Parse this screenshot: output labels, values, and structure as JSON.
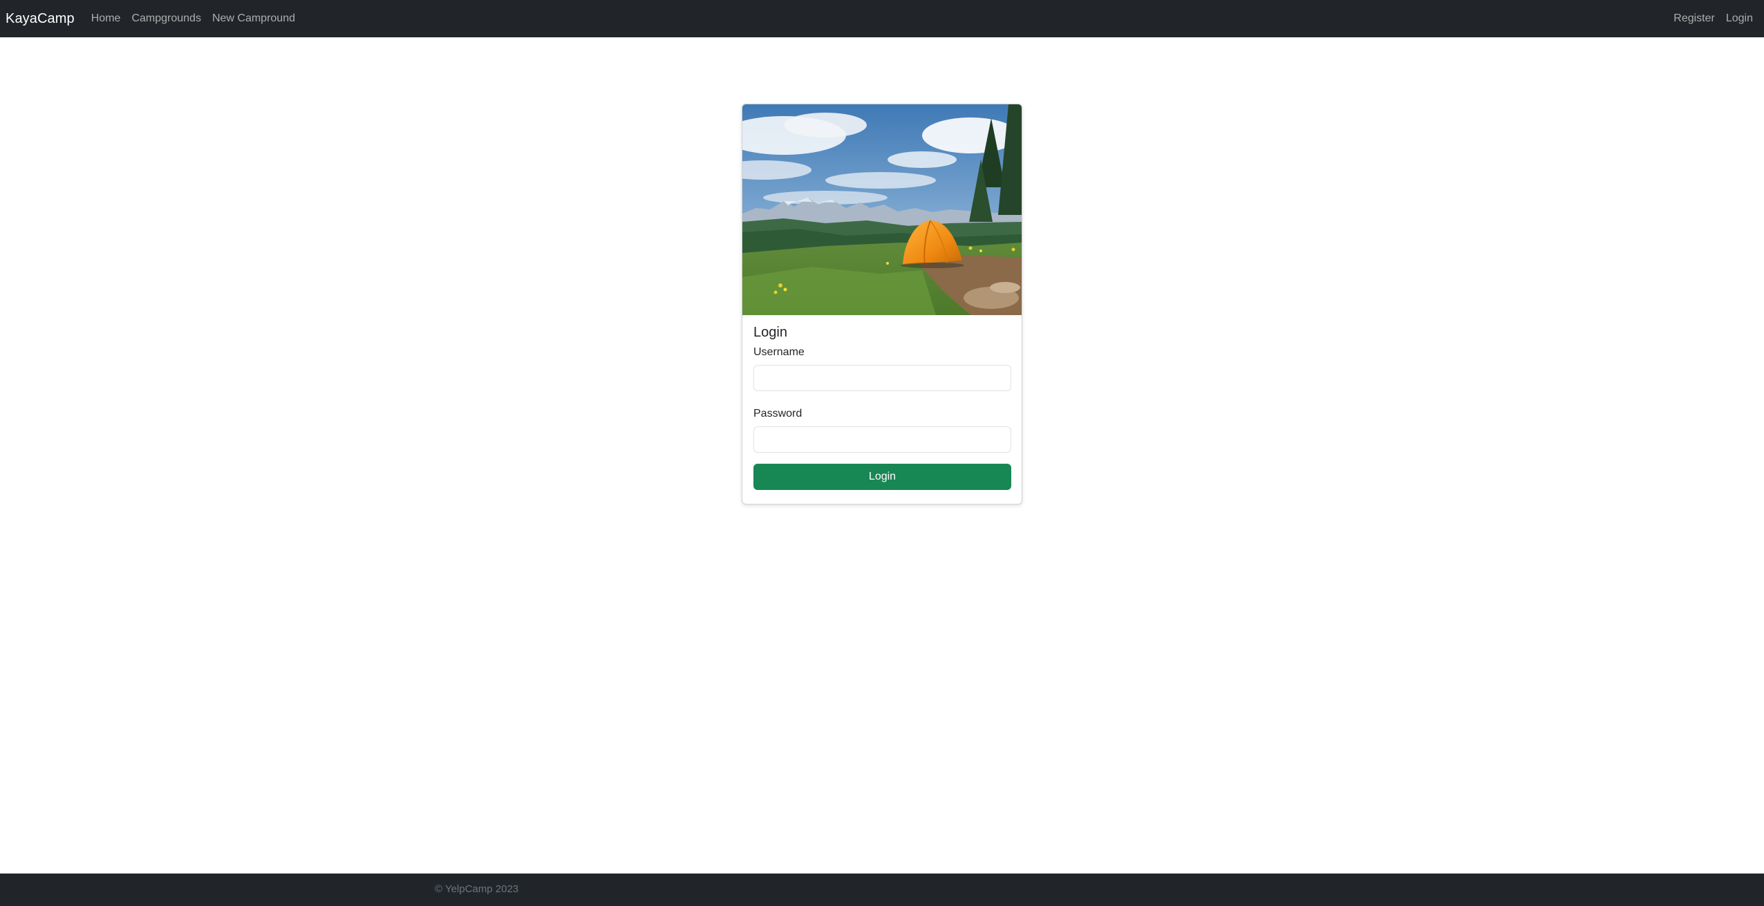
{
  "navbar": {
    "brand": "KayaCamp",
    "links": [
      {
        "label": "Home"
      },
      {
        "label": "Campgrounds"
      },
      {
        "label": "New Campround"
      }
    ],
    "right_links": [
      {
        "label": "Register"
      },
      {
        "label": "Login"
      }
    ]
  },
  "login_card": {
    "image": {
      "subject": "orange tent on grassy hillside with mountains"
    },
    "title": "Login",
    "username": {
      "label": "Username",
      "value": "",
      "placeholder": ""
    },
    "password": {
      "label": "Password",
      "value": "",
      "placeholder": ""
    },
    "submit_label": "Login"
  },
  "footer": {
    "text": "© YelpCamp 2023"
  },
  "colors": {
    "navbar_bg": "#212529",
    "accent": "#198754",
    "tent": "#f08a12",
    "footer_text": "#6c757d"
  }
}
